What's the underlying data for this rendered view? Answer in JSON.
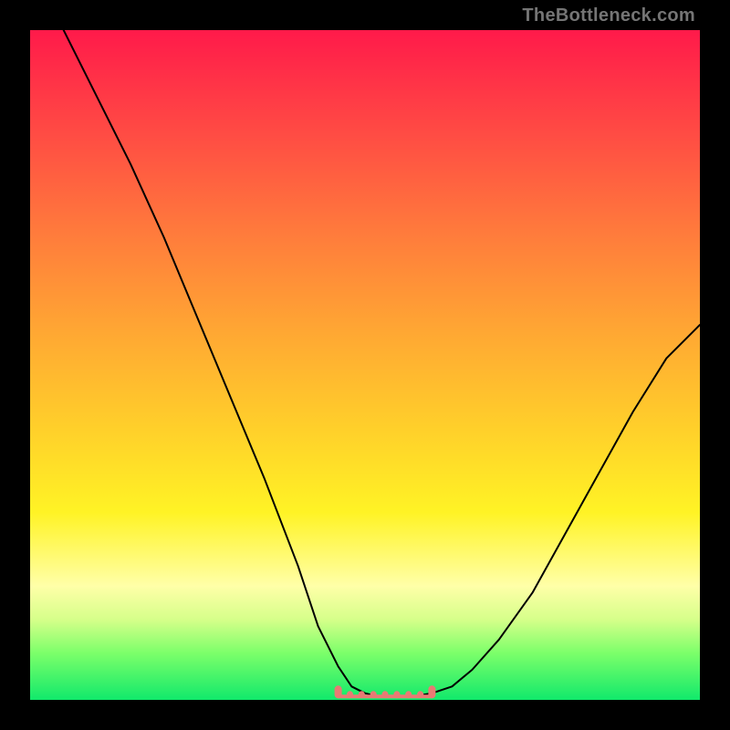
{
  "watermark": "TheBottleneck.com",
  "chart_data": {
    "type": "line",
    "title": "",
    "xlabel": "",
    "ylabel": "",
    "xlim": [
      0,
      100
    ],
    "ylim": [
      0,
      100
    ],
    "grid": false,
    "series": [
      {
        "name": "curve",
        "color": "#000000",
        "x": [
          5,
          10,
          15,
          20,
          25,
          30,
          35,
          40,
          43,
          46,
          48,
          50,
          52,
          55,
          57,
          60,
          63,
          66,
          70,
          75,
          80,
          85,
          90,
          95,
          100
        ],
        "y": [
          100,
          90,
          80,
          69,
          57,
          45,
          33,
          20,
          11,
          5,
          2,
          1,
          0.5,
          0.5,
          0.5,
          1,
          2,
          4.5,
          9,
          16,
          25,
          34,
          43,
          51,
          56
        ]
      }
    ],
    "flat_zone": {
      "comment": "salmon dotted tick region at trough",
      "x_start": 46,
      "x_end": 60,
      "y": 0.5,
      "color": "#e97a74"
    }
  }
}
